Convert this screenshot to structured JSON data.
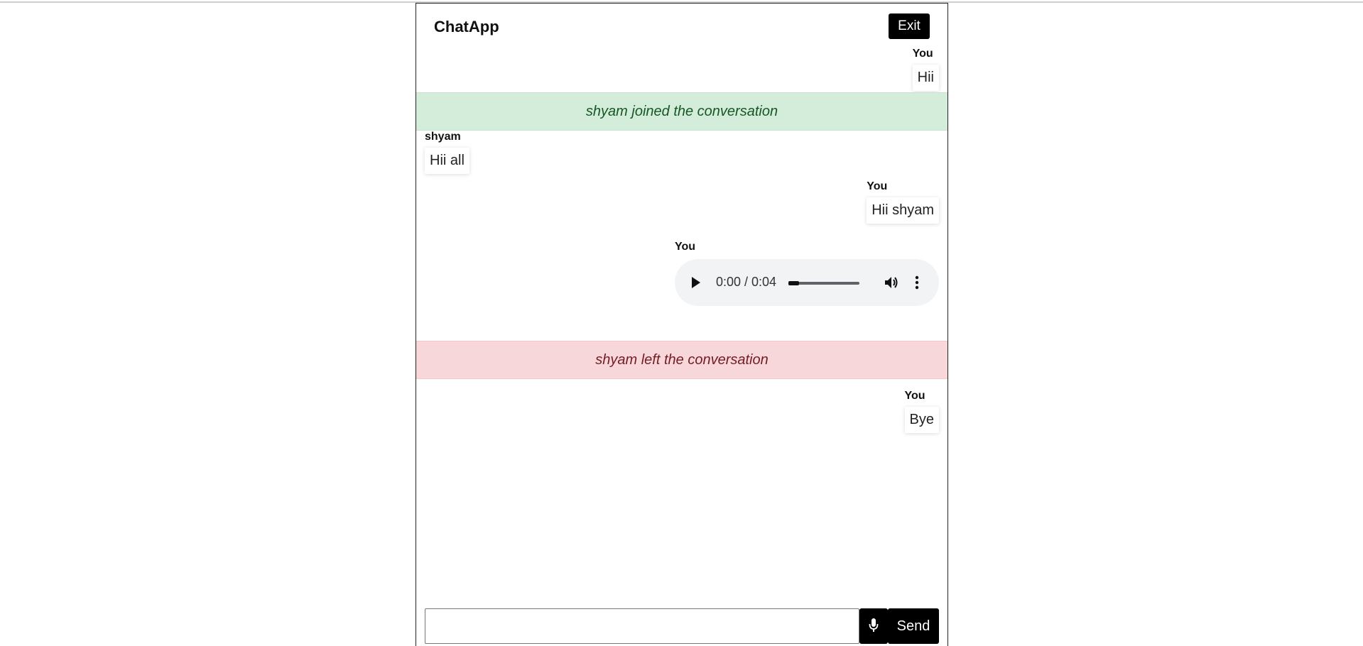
{
  "app": {
    "title": "ChatApp",
    "exit_label": "Exit"
  },
  "messages": [
    {
      "sender": "You",
      "text": "Hii",
      "side": "right"
    },
    {
      "notice": "shyam joined the conversation",
      "kind": "join"
    },
    {
      "sender": "shyam",
      "text": "Hii all",
      "side": "left"
    },
    {
      "sender": "You",
      "text": "Hii shyam",
      "side": "right"
    },
    {
      "sender": "You",
      "audio": {
        "time": "0:00 / 0:04",
        "progress": 0.15
      },
      "side": "right"
    },
    {
      "notice": "shyam left the conversation",
      "kind": "leave"
    },
    {
      "sender": "You",
      "text": "Bye",
      "side": "right"
    }
  ],
  "composer": {
    "input_value": "",
    "placeholder": "",
    "mic_icon": "microphone-icon",
    "send_label": "Send"
  },
  "colors": {
    "join_bg": "#d4edda",
    "join_text": "#155724",
    "leave_bg": "#f8d7da",
    "leave_text": "#721c24",
    "button_bg": "#000000"
  }
}
